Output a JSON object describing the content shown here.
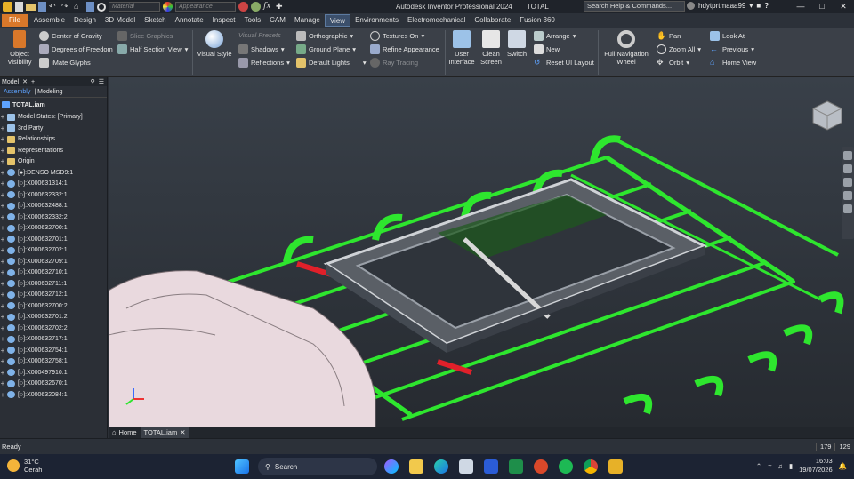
{
  "titlebar": {
    "material_placeholder": "Material",
    "appearance_placeholder": "Appearance",
    "app_title": "Autodesk Inventor Professional 2024",
    "doc_title": "TOTAL",
    "search_placeholder": "Search Help & Commands...",
    "user": "hdytprtmaaa99",
    "help": "?"
  },
  "menu": {
    "items": [
      "File",
      "Assemble",
      "Design",
      "3D Model",
      "Sketch",
      "Annotate",
      "Inspect",
      "Tools",
      "CAM",
      "Manage",
      "View",
      "Environments",
      "Electromechanical",
      "Collaborate",
      "Fusion 360"
    ],
    "active": "View"
  },
  "ribbon": {
    "visibility": {
      "object_visibility": "Object Visibility",
      "center_of_gravity": "Center of Gravity",
      "degrees_of_freedom": "Degrees of Freedom",
      "imate_glyphs": "iMate Glyphs",
      "slice_graphics": "Slice Graphics",
      "half_section_view": "Half Section View"
    },
    "appearance": {
      "visual_style": "Visual Style",
      "visual_presets": "Visual Presets",
      "shadows": "Shadows",
      "reflections": "Reflections",
      "orthographic": "Orthographic",
      "ground_plane": "Ground Plane",
      "default_lights": "Default Lights",
      "textures_on": "Textures On",
      "refine_appearance": "Refine Appearance",
      "ray_tracing": "Ray Tracing"
    },
    "windows": {
      "user_interface": "User Interface",
      "clean_screen": "Clean Screen",
      "switch": "Switch",
      "arrange": "Arrange",
      "new": "New",
      "reset_ui_layout": "Reset UI Layout"
    },
    "navigate": {
      "full_navigation_wheel": "Full Navigation Wheel",
      "pan": "Pan",
      "zoom_all": "Zoom All",
      "orbit": "Orbit",
      "look_at": "Look At",
      "previous": "Previous",
      "home_view": "Home View"
    }
  },
  "browser": {
    "title": "Model",
    "tabs": [
      "Assembly",
      "Modeling"
    ],
    "root": "TOTAL.iam",
    "items": [
      {
        "label": "Model States: [Primary]",
        "icon": "doc"
      },
      {
        "label": "3rd Party",
        "icon": "doc"
      },
      {
        "label": "Relationships",
        "icon": "fold"
      },
      {
        "label": "Representations",
        "icon": "fold"
      },
      {
        "label": "Origin",
        "icon": "fold"
      },
      {
        "label": "[●]:DENSO    MSD9:1",
        "icon": "part"
      },
      {
        "label": "[○]:X000631314:1",
        "icon": "part"
      },
      {
        "label": "[○]:X000632332:1",
        "icon": "part"
      },
      {
        "label": "[○]:X000632488:1",
        "icon": "part"
      },
      {
        "label": "[○]:X000632332:2",
        "icon": "part"
      },
      {
        "label": "[○]:X000632700:1",
        "icon": "part"
      },
      {
        "label": "[○]:X000632701:1",
        "icon": "part"
      },
      {
        "label": "[○]:X000632702:1",
        "icon": "part"
      },
      {
        "label": "[○]:X000632709:1",
        "icon": "part"
      },
      {
        "label": "[○]:X000632710:1",
        "icon": "part"
      },
      {
        "label": "[○]:X000632711:1",
        "icon": "part"
      },
      {
        "label": "[○]:X000632712:1",
        "icon": "part"
      },
      {
        "label": "[○]:X000632700:2",
        "icon": "part"
      },
      {
        "label": "[○]:X000632701:2",
        "icon": "part"
      },
      {
        "label": "[○]:X000632702:2",
        "icon": "part"
      },
      {
        "label": "[○]:X000632717:1",
        "icon": "part"
      },
      {
        "label": "[○]:X000632754:1",
        "icon": "part"
      },
      {
        "label": "[○]:X000632758:1",
        "icon": "part"
      },
      {
        "label": "[○]:X000497910:1",
        "icon": "part"
      },
      {
        "label": "[○]:X000632670:1",
        "icon": "part"
      },
      {
        "label": "[○]:X000632084:1",
        "icon": "part"
      }
    ]
  },
  "doctabs": {
    "home": "Home",
    "file": "TOTAL.iam"
  },
  "status": {
    "text": "Ready",
    "count1": "179",
    "count2": "129"
  },
  "taskbar": {
    "temp": "31°C",
    "weather": "Cerah",
    "search": "Search",
    "time": "16:03",
    "date": "19/07/2026"
  },
  "colors": {
    "accent_file": "#d9782a",
    "frame_green": "#2ee62e",
    "rail_red": "#e0202a"
  }
}
